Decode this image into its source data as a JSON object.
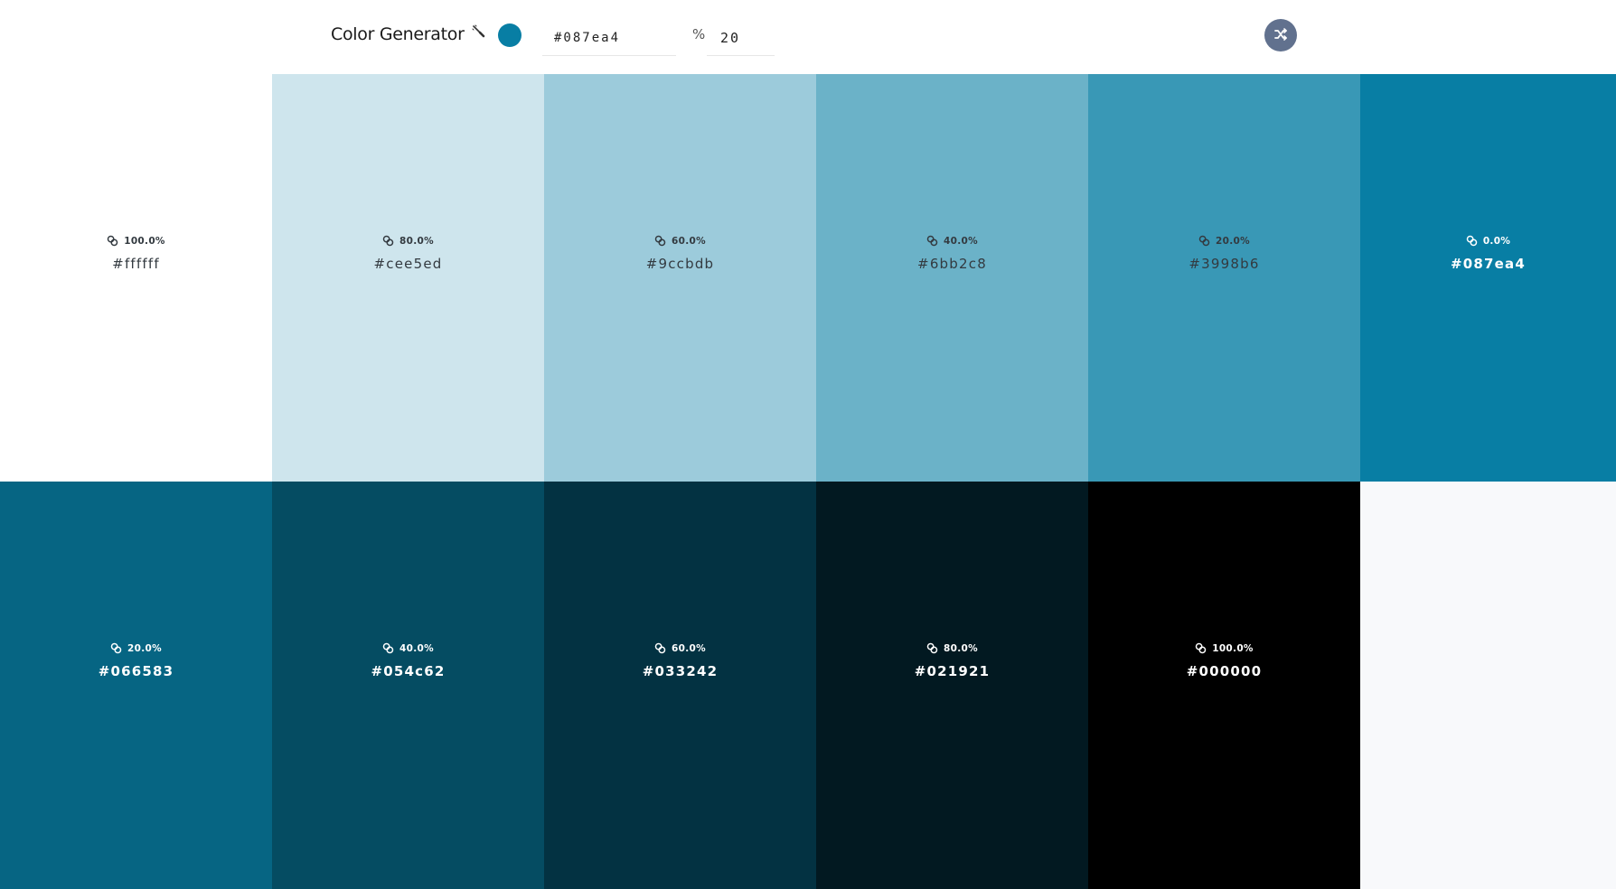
{
  "header": {
    "title": "Color Generator",
    "picker_icon": "eyedropper-icon",
    "selected_color": "#087ea4",
    "hex_value": "#087ea4",
    "percent_icon": "percent-icon",
    "weight_value": "20",
    "random_icon": "shuffle-icon",
    "random_button_color": "#61718e"
  },
  "swatches": [
    {
      "percent": "100.0%",
      "hex": "#ffffff",
      "color": "#ffffff",
      "tone": "light"
    },
    {
      "percent": "80.0%",
      "hex": "#cee5ed",
      "color": "#cee5ed",
      "tone": "light"
    },
    {
      "percent": "60.0%",
      "hex": "#9ccbdb",
      "color": "#9ccbdb",
      "tone": "light"
    },
    {
      "percent": "40.0%",
      "hex": "#6bb2c8",
      "color": "#6bb2c8",
      "tone": "light"
    },
    {
      "percent": "20.0%",
      "hex": "#3998b6",
      "color": "#3998b6",
      "tone": "light"
    },
    {
      "percent": "0.0%",
      "hex": "#087ea4",
      "color": "#087ea4",
      "tone": "dark"
    },
    {
      "percent": "20.0%",
      "hex": "#066583",
      "color": "#066583",
      "tone": "dark"
    },
    {
      "percent": "40.0%",
      "hex": "#054c62",
      "color": "#054c62",
      "tone": "dark"
    },
    {
      "percent": "60.0%",
      "hex": "#033242",
      "color": "#033242",
      "tone": "dark"
    },
    {
      "percent": "80.0%",
      "hex": "#021921",
      "color": "#021921",
      "tone": "dark"
    },
    {
      "percent": "100.0%",
      "hex": "#000000",
      "color": "#000000",
      "tone": "dark"
    }
  ],
  "copy_icon": "copy-icon",
  "background_color": "#f8f9fb"
}
